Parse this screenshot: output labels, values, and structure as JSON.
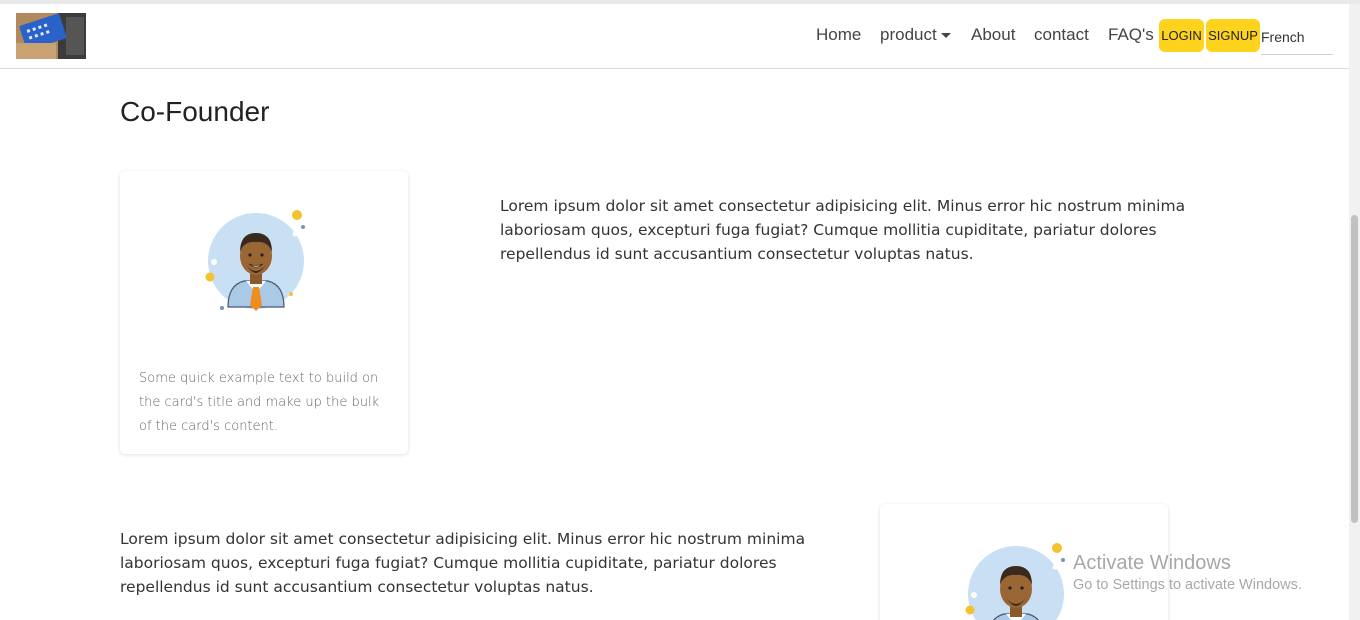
{
  "nav": {
    "items": [
      "Home",
      "product",
      "About",
      "contact",
      "FAQ's"
    ],
    "login_label": "LOGIN",
    "signup_label": "SIGNUP",
    "language": "French"
  },
  "main": {
    "title": "Co-Founder",
    "card_text": "Some quick example text to build on the card's title and make up the bulk of the card's content.",
    "paragraph_1": "Lorem ipsum dolor sit amet consectetur adipisicing elit. Minus error hic nostrum minima laboriosam quos, excepturi fuga fugiat? Cumque mollitia cupiditate, pariatur dolores repellendus id sunt accusantium consectetur voluptas natus.",
    "paragraph_2": "Lorem ipsum dolor sit amet consectetur adipisicing elit. Minus error hic nostrum minima laboriosam quos, excepturi fuga fugiat? Cumque mollitia cupiditate, pariatur dolores repellendus id sunt accusantium consectetur voluptas natus."
  },
  "watermark": {
    "title": "Activate Windows",
    "subtitle": "Go to Settings to activate Windows."
  },
  "icons": [
    "logo-image",
    "chevron-down-icon",
    "avatar-icon"
  ],
  "colors": {
    "button_yellow": "#fdd31e",
    "avatar_circle": "#c9dff3",
    "tie_orange": "#f08c1e"
  }
}
